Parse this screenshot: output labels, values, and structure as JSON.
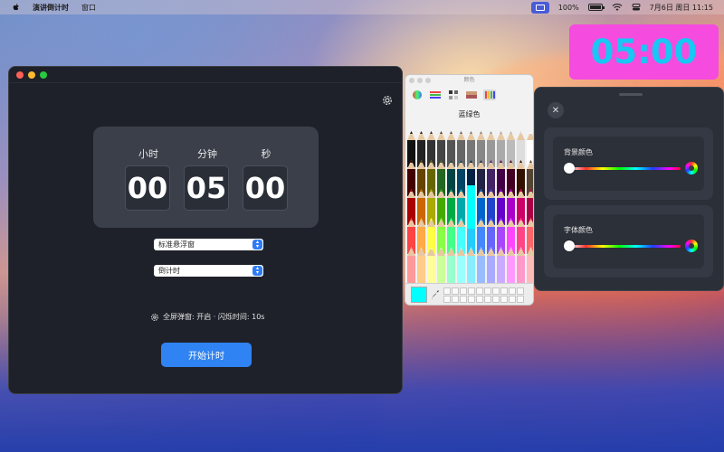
{
  "menubar": {
    "app_name": "演讲倒计时",
    "menu_window": "窗口",
    "battery_percent": "100%",
    "datetime": "7月6日 周日  11:15"
  },
  "floating_timer": {
    "time": "05:00",
    "background_color": "#f54bdf",
    "text_color": "#17c7f4"
  },
  "main_window": {
    "units": {
      "hours_label": "小时",
      "minutes_label": "分钟",
      "seconds_label": "秒"
    },
    "values": {
      "hours": "00",
      "minutes": "05",
      "seconds": "00"
    },
    "window_mode_select": "标准悬浮窗",
    "count_mode_select": "倒计时",
    "status_text": "全屏弹窗: 开启 · 闪烁时间: 10s",
    "start_button": "开始计时",
    "accent_color": "#2f83f2"
  },
  "color_panel": {
    "title": "颜色",
    "selected_color_name": "蓝绿色",
    "selected_color": "#00ffff",
    "tabs": [
      "color-wheel-icon",
      "color-sliders-icon",
      "color-palettes-icon",
      "image-palettes-icon",
      "pencils-icon"
    ]
  },
  "settings_panel": {
    "background_color_label": "背景颜色",
    "font_color_label": "字体颜色"
  }
}
